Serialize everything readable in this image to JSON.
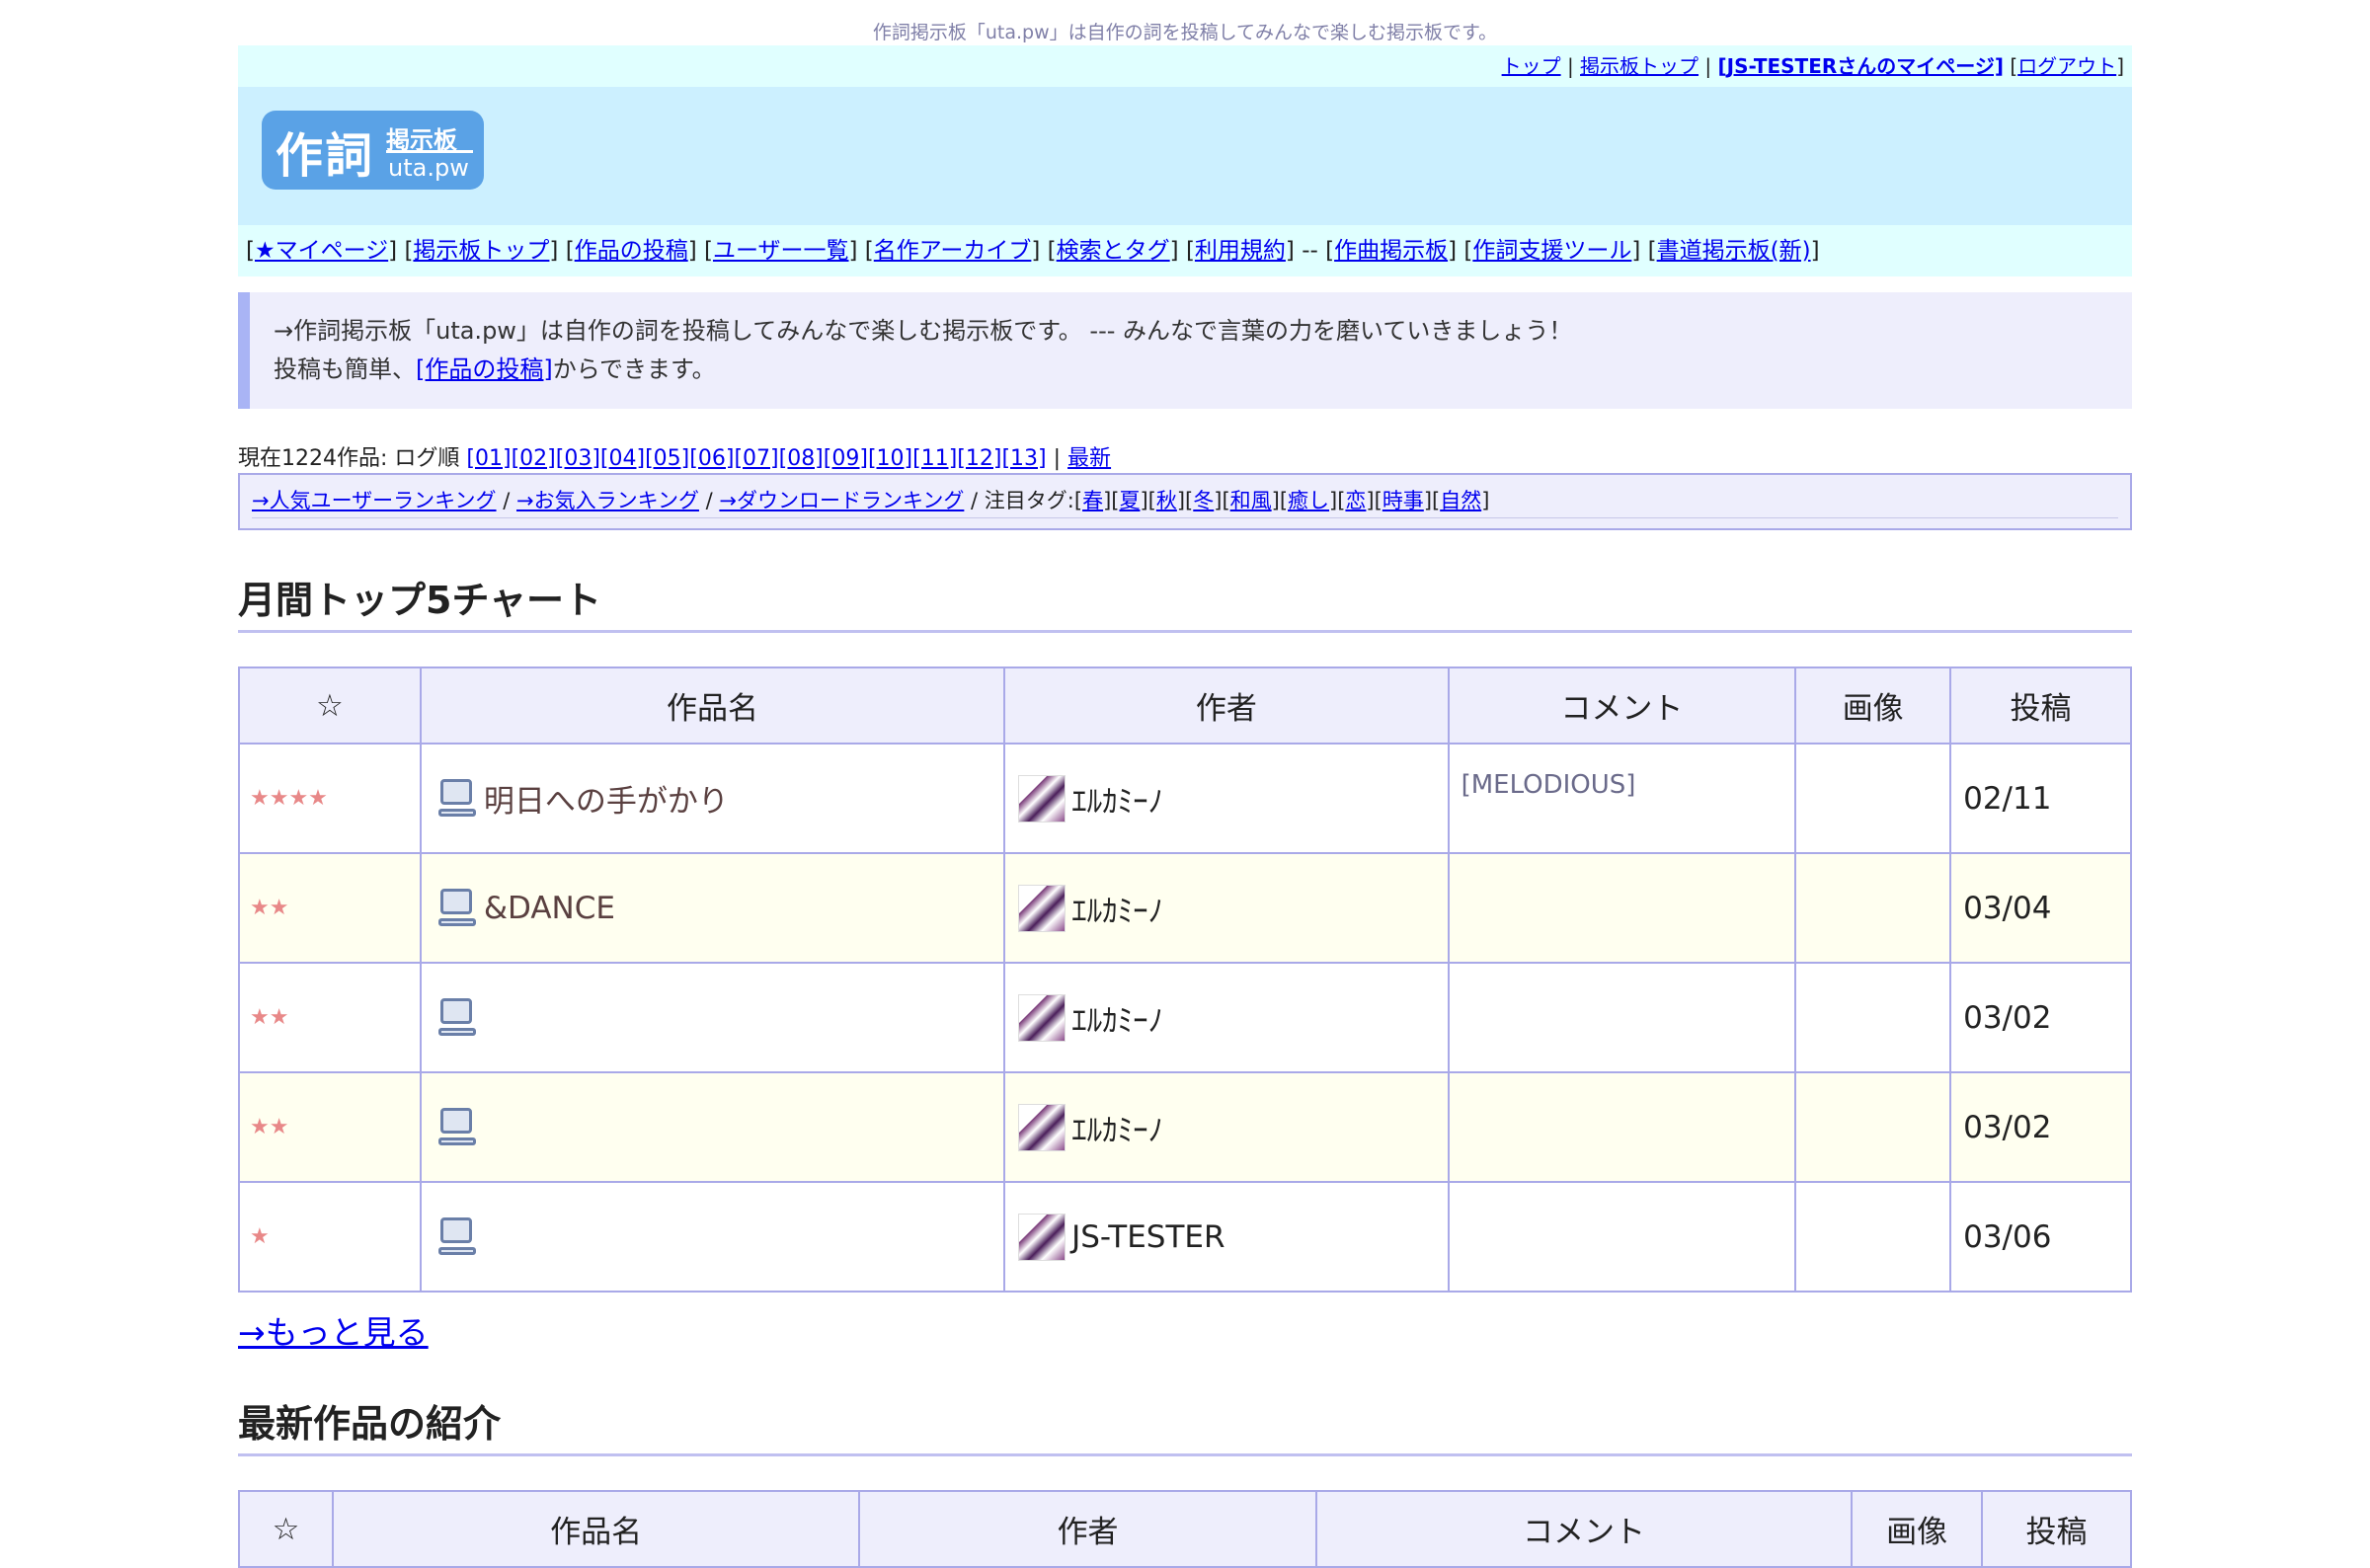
{
  "header": {
    "tagline": "作詞掲示板「uta.pw」は自作の詞を投稿してみんなで楽しむ掲示板です。",
    "links": [
      "トップ",
      "掲示板トップ",
      "[JS-TESTERさんのマイページ]",
      "ログアウト"
    ],
    "logo": {
      "main": "作詞",
      "sub1": "掲示板",
      "sub2": "uta.pw"
    }
  },
  "nav": {
    "items": [
      "★マイページ",
      "掲示板トップ",
      "作品の投稿",
      "ユーザー一覧",
      "名作アーカイブ",
      "検索とタグ",
      "利用規約",
      "作曲掲示板",
      "作詞支援ツール",
      "書道掲示板(新)"
    ]
  },
  "notice": {
    "line1": "→作詞掲示板「uta.pw」は自作の詞を投稿してみんなで楽しむ掲示板です。 --- みんなで言葉の力を磨いていきましょう！",
    "line2_prefix": "投稿も簡単、",
    "line2_link": "[作品の投稿]",
    "line2_suffix": "からできます。"
  },
  "log": {
    "prefix": "現在1224作品: ログ順",
    "pages": [
      "[01]",
      "[02]",
      "[03]",
      "[04]",
      "[05]",
      "[06]",
      "[07]",
      "[08]",
      "[09]",
      "[10]",
      "[11]",
      "[12]",
      "[13]"
    ],
    "latest": "最新"
  },
  "rankbar": {
    "links": [
      "→人気ユーザーランキング",
      "→お気入ランキング",
      "→ダウンロードランキング"
    ],
    "tags_label": "注目タグ:",
    "tags": [
      "春",
      "夏",
      "秋",
      "冬",
      "和風",
      "癒し",
      "恋",
      "時事",
      "自然"
    ]
  },
  "top5": {
    "heading": "月間トップ5チャート",
    "columns": [
      "☆",
      "作品名",
      "作者",
      "コメント",
      "画像",
      "投稿"
    ],
    "rows": [
      {
        "stars": "★★★★",
        "title": "明日への手がかり",
        "author": "ｴﾙｶﾐｰﾉ",
        "comment": "[MELODIOUS]",
        "date": "02/11"
      },
      {
        "stars": "★★",
        "title": "&DANCE",
        "author": "ｴﾙｶﾐｰﾉ",
        "comment": "",
        "date": "03/04"
      },
      {
        "stars": "★★",
        "title": "",
        "author": "ｴﾙｶﾐｰﾉ",
        "comment": "",
        "date": "03/02"
      },
      {
        "stars": "★★",
        "title": "",
        "author": "ｴﾙｶﾐｰﾉ",
        "comment": "",
        "date": "03/02"
      },
      {
        "stars": "★",
        "title": "",
        "author": "JS-TESTER",
        "comment": "",
        "date": "03/06"
      }
    ],
    "more": "→もっと見る"
  },
  "latest": {
    "heading": "最新作品の紹介",
    "columns": [
      "☆",
      "作品名",
      "作者",
      "コメント",
      "画像",
      "投稿"
    ]
  },
  "colors": {
    "accent": "#a9a9e8",
    "nav_bg": "#e0ffff",
    "banner_bg": "#ccf0ff",
    "notice_bg": "#eeeefc",
    "row_alt": "#fffff0"
  },
  "icons": {
    "work": "computer-icon",
    "author": "avatar-image"
  }
}
